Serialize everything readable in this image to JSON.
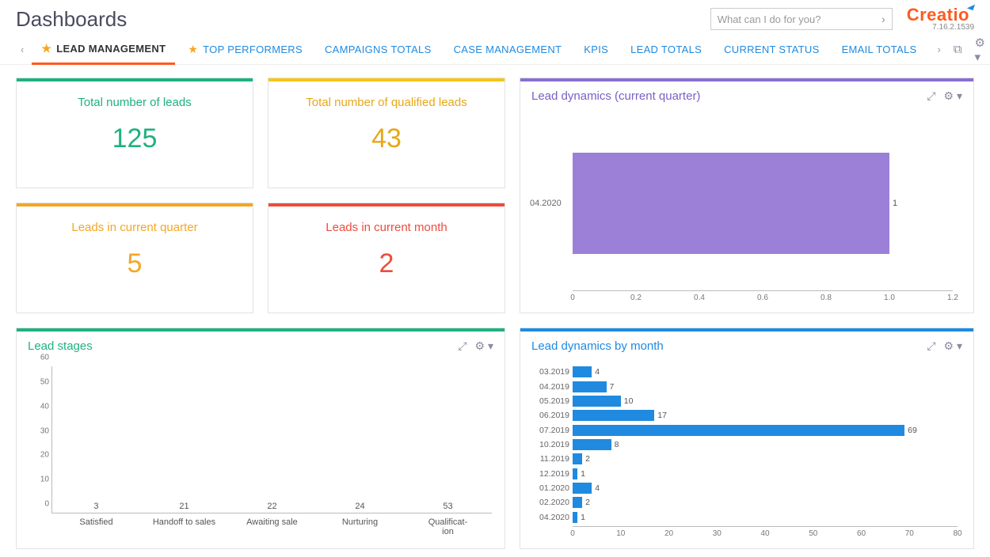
{
  "header": {
    "title": "Dashboards",
    "search_placeholder": "What can I do for you?",
    "brand": "Creatio",
    "version": "7.16.2.1539"
  },
  "tabs": [
    {
      "label": "LEAD MANAGEMENT",
      "starred": true,
      "active": true
    },
    {
      "label": "TOP PERFORMERS",
      "starred": true,
      "active": false
    },
    {
      "label": "CAMPAIGNS TOTALS",
      "starred": false,
      "active": false
    },
    {
      "label": "CASE MANAGEMENT",
      "starred": false,
      "active": false
    },
    {
      "label": "KPIS",
      "starred": false,
      "active": false
    },
    {
      "label": "LEAD TOTALS",
      "starred": false,
      "active": false
    },
    {
      "label": "CURRENT STATUS",
      "starred": false,
      "active": false
    },
    {
      "label": "EMAIL TOTALS",
      "starred": false,
      "active": false
    }
  ],
  "metrics": {
    "total_leads": {
      "title": "Total number of leads",
      "value": "125"
    },
    "qualified_leads": {
      "title": "Total number of qualified leads",
      "value": "43"
    },
    "leads_quarter": {
      "title": "Leads in current quarter",
      "value": "5"
    },
    "leads_month": {
      "title": "Leads in current month",
      "value": "2"
    }
  },
  "panels": {
    "lead_dynamics_quarter": {
      "title": "Lead dynamics (current quarter)"
    },
    "lead_stages": {
      "title": "Lead stages"
    },
    "lead_dynamics_month": {
      "title": "Lead dynamics by month"
    }
  },
  "chart_data": [
    {
      "id": "lead_dynamics_quarter",
      "type": "bar",
      "orientation": "horizontal",
      "categories": [
        "04.2020"
      ],
      "values": [
        1
      ],
      "xlim": [
        0,
        1.2
      ],
      "xticks": [
        0,
        0.2,
        0.4,
        0.6,
        0.8,
        1.0,
        1.2
      ],
      "color": "#9c80d8"
    },
    {
      "id": "lead_stages",
      "type": "bar",
      "orientation": "vertical",
      "categories": [
        "Satisfied",
        "Handoff to sales",
        "Awaiting sale",
        "Nurturing",
        "Qualificat-\nion"
      ],
      "values": [
        3,
        21,
        22,
        24,
        53
      ],
      "ylim": [
        0,
        60
      ],
      "yticks": [
        0,
        10,
        20,
        30,
        40,
        50,
        60
      ],
      "color": "#1fb180"
    },
    {
      "id": "lead_dynamics_month",
      "type": "bar",
      "orientation": "horizontal",
      "categories": [
        "03.2019",
        "04.2019",
        "05.2019",
        "06.2019",
        "07.2019",
        "10.2019",
        "11.2019",
        "12.2019",
        "01.2020",
        "02.2020",
        "04.2020"
      ],
      "values": [
        4,
        7,
        10,
        17,
        69,
        8,
        2,
        1,
        4,
        2,
        1
      ],
      "xlim": [
        0,
        80
      ],
      "xticks": [
        0,
        10,
        20,
        30,
        40,
        50,
        60,
        70,
        80
      ],
      "color": "#1f8ae0"
    }
  ]
}
